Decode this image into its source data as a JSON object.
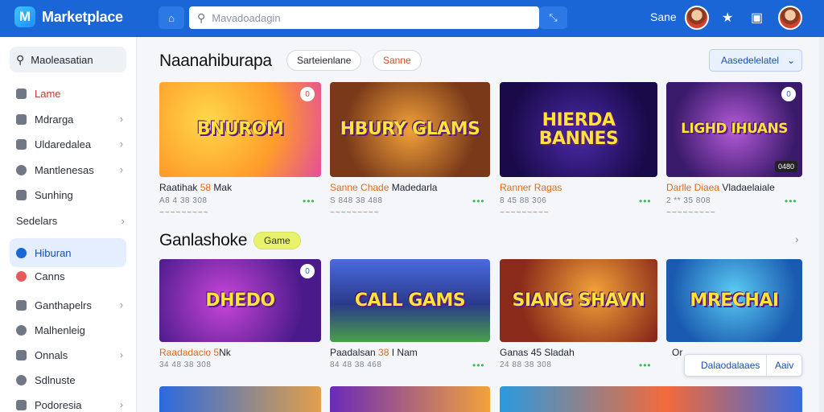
{
  "header": {
    "logo_letter": "M",
    "app_title": "Marketplace",
    "search_placeholder": "Mavadoadagin",
    "user_name": "Sane"
  },
  "sidebar": {
    "search_label": "Maoleasatian",
    "items": [
      {
        "label": "Lame",
        "icon": "grid-icon"
      },
      {
        "label": "Mdrarga",
        "icon": "puzzle-icon"
      },
      {
        "label": "Uldaredalea",
        "icon": "box-icon"
      },
      {
        "label": "Mantlenesas",
        "icon": "clock-icon"
      },
      {
        "label": "Sunhing",
        "icon": "tag-icon"
      }
    ],
    "group_label": "Sedelars",
    "items2": [
      {
        "label": "Hiburan",
        "icon": "gamepad-icon",
        "active": true
      },
      {
        "label": "Canns",
        "icon": "heart-icon"
      },
      {
        "label": "Ganthapelrs",
        "icon": "shopping-icon"
      },
      {
        "label": "Malhenleig",
        "icon": "chat-icon"
      },
      {
        "label": "Onnals",
        "icon": "lock-icon"
      },
      {
        "label": "Sdlnuste",
        "icon": "star-icon"
      },
      {
        "label": "Podoresia",
        "icon": "folder-icon"
      }
    ]
  },
  "main": {
    "section1": {
      "title": "Naanahiburapa",
      "chip1": "Sarteienlane",
      "chip2": "Sanne",
      "sort_label": "Aasedelelatel"
    },
    "section2": {
      "title": "Ganlashoke",
      "chip": "Game"
    },
    "row1": [
      {
        "art": "BNUROM",
        "title_a": "Raatihak ",
        "title_hl": "58",
        "title_b": " Mak",
        "sub": "A8 4 38 308",
        "price": "~~~~~~~~~",
        "corner": "0"
      },
      {
        "art": "HBURY GLAMS",
        "title_a": "",
        "title_hl": "Sanne Chade",
        "title_b": " Madedarla",
        "sub": "S 848 38 488",
        "price": "~~~~~~~~~"
      },
      {
        "art": "HIERDA BANNES",
        "title_a": "",
        "title_hl": "Ranner Ragas",
        "title_b": "",
        "sub": "8 45 88 306",
        "price": "~~~~~~~~~"
      },
      {
        "art": "LIGHD IHUANS",
        "title_a": "",
        "title_hl": "Darlle Diaea",
        "title_b": " Vladaelaiale",
        "sub": "2 ** 35 808",
        "price": "~~~~~~~~~",
        "corner": "0",
        "tag": "0480"
      }
    ],
    "row2": [
      {
        "art": "DHEDO",
        "title_a": "",
        "title_hl": "Raadadacio 5",
        "title_b": "Nk",
        "sub": "34 48 38 308",
        "corner": "0"
      },
      {
        "art": "CALL GAMS",
        "title_a": "Paadalsan ",
        "title_hl": "38",
        "title_b": " I Nam",
        "sub": "84 48 38 468"
      },
      {
        "art": "SIANG SHAVN",
        "title_a": "Ganas 45 Sladah",
        "title_hl": "",
        "title_b": "",
        "sub": "24 88 38 308"
      },
      {
        "art": "MRECHAI",
        "title_a": "Or",
        "title_hl": "",
        "title_b": "",
        "sub": ""
      }
    ],
    "popover": {
      "primary": "Dalaodalaaes",
      "secondary": "Aaiv"
    }
  }
}
